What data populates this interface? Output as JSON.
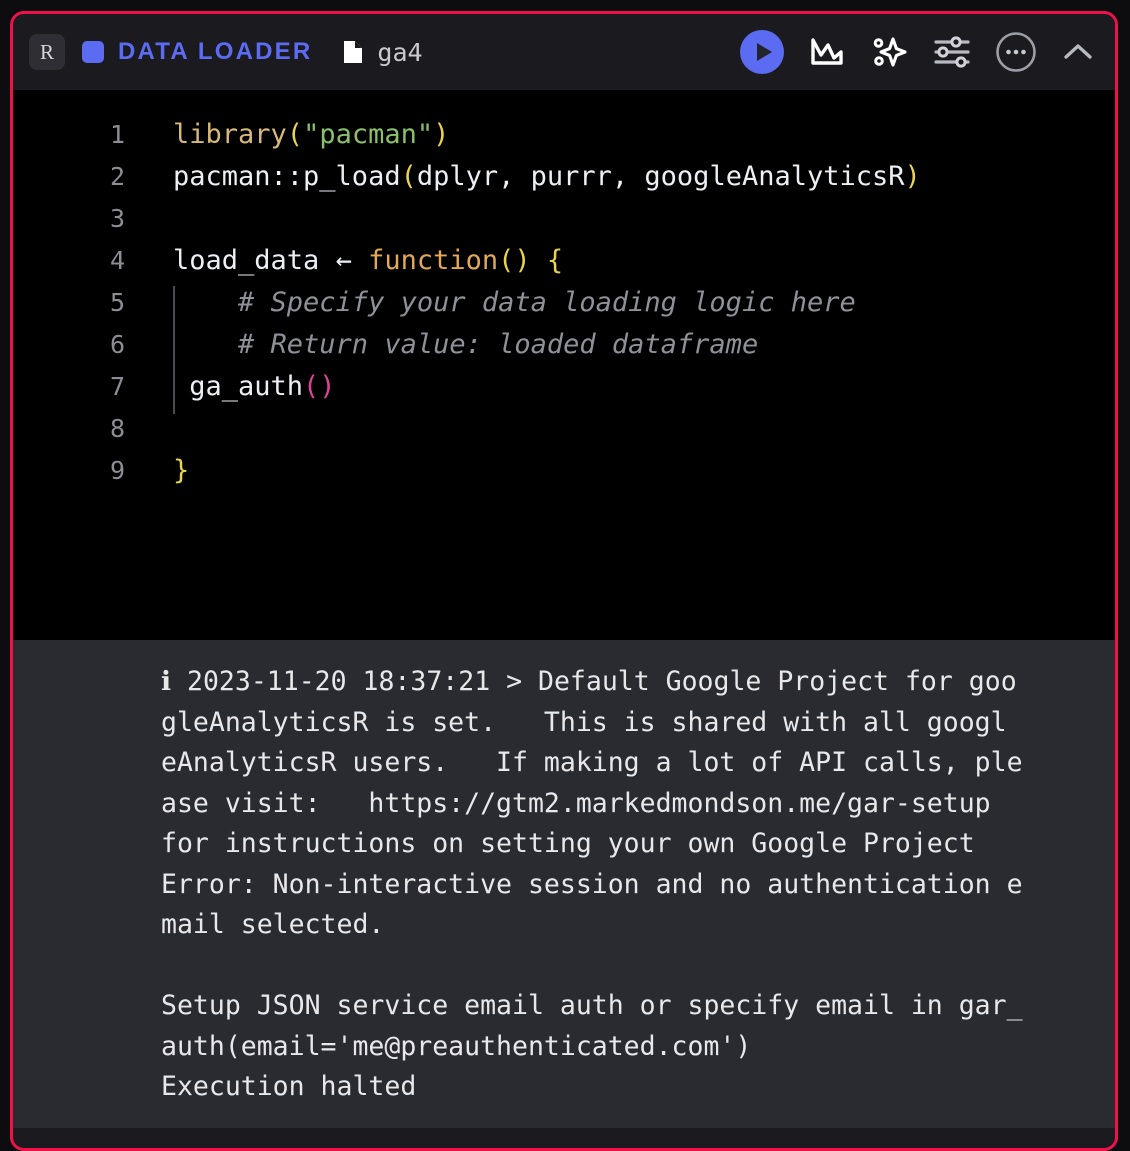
{
  "block": {
    "language_badge": "R",
    "kind_label": "DATA  LOADER",
    "file_name": "ga4",
    "accent_color": "#5c6cf2",
    "selection_border_color": "#f0104a",
    "editor_background": "#000000",
    "output_background": "#2a2b31"
  },
  "toolbar": {
    "run_label": "play-icon",
    "chart_label": "area-chart-icon",
    "ai_label": "sparkle-icon",
    "settings_label": "sliders-icon",
    "more_label": "ellipsis-icon",
    "collapse_label": "chevron-up-icon"
  },
  "code": {
    "lines": [
      {
        "n": "1",
        "guide": false
      },
      {
        "n": "2",
        "guide": false
      },
      {
        "n": "3",
        "guide": false
      },
      {
        "n": "4",
        "guide": false
      },
      {
        "n": "5",
        "guide": true
      },
      {
        "n": "6",
        "guide": true
      },
      {
        "n": "7",
        "guide": true
      },
      {
        "n": "8",
        "guide": true
      },
      {
        "n": "9",
        "guide": false
      }
    ],
    "line1_fn": "library",
    "line1_open": "(",
    "line1_str": "\"pacman\"",
    "line1_close": ")",
    "line2_pre": "pacman::p_load",
    "line2_open": "(",
    "line2_args": "dplyr, purrr, googleAnalyticsR",
    "line2_close": ")",
    "line3": "",
    "line4_name": "load_data ",
    "line4_arrow": "←",
    "line4_kw": " function",
    "line4_parens": "()",
    "line4_brace": " {",
    "line5_comment": "    # Specify your data loading logic here",
    "line6_comment": "    # Return value: loaded dataframe",
    "line7_name": " ga_auth",
    "line7_parens": "()",
    "line8": "",
    "line9_brace": "}"
  },
  "output": {
    "lines": [
      "ℹ 2023-11-20 18:37:21 > Default Google Project for goo",
      "gleAnalyticsR is set.   This is shared with all googl",
      "eAnalyticsR users.   If making a lot of API calls, ple",
      "ase visit:   https://gtm2.markedmondson.me/gar-setup",
      "for instructions on setting your own Google Project",
      "Error: Non-interactive session and no authentication e",
      "mail selected.",
      "",
      "Setup JSON service email auth or specify email in gar_",
      "auth(email='me@preauthenticated.com')",
      "Execution halted"
    ]
  }
}
